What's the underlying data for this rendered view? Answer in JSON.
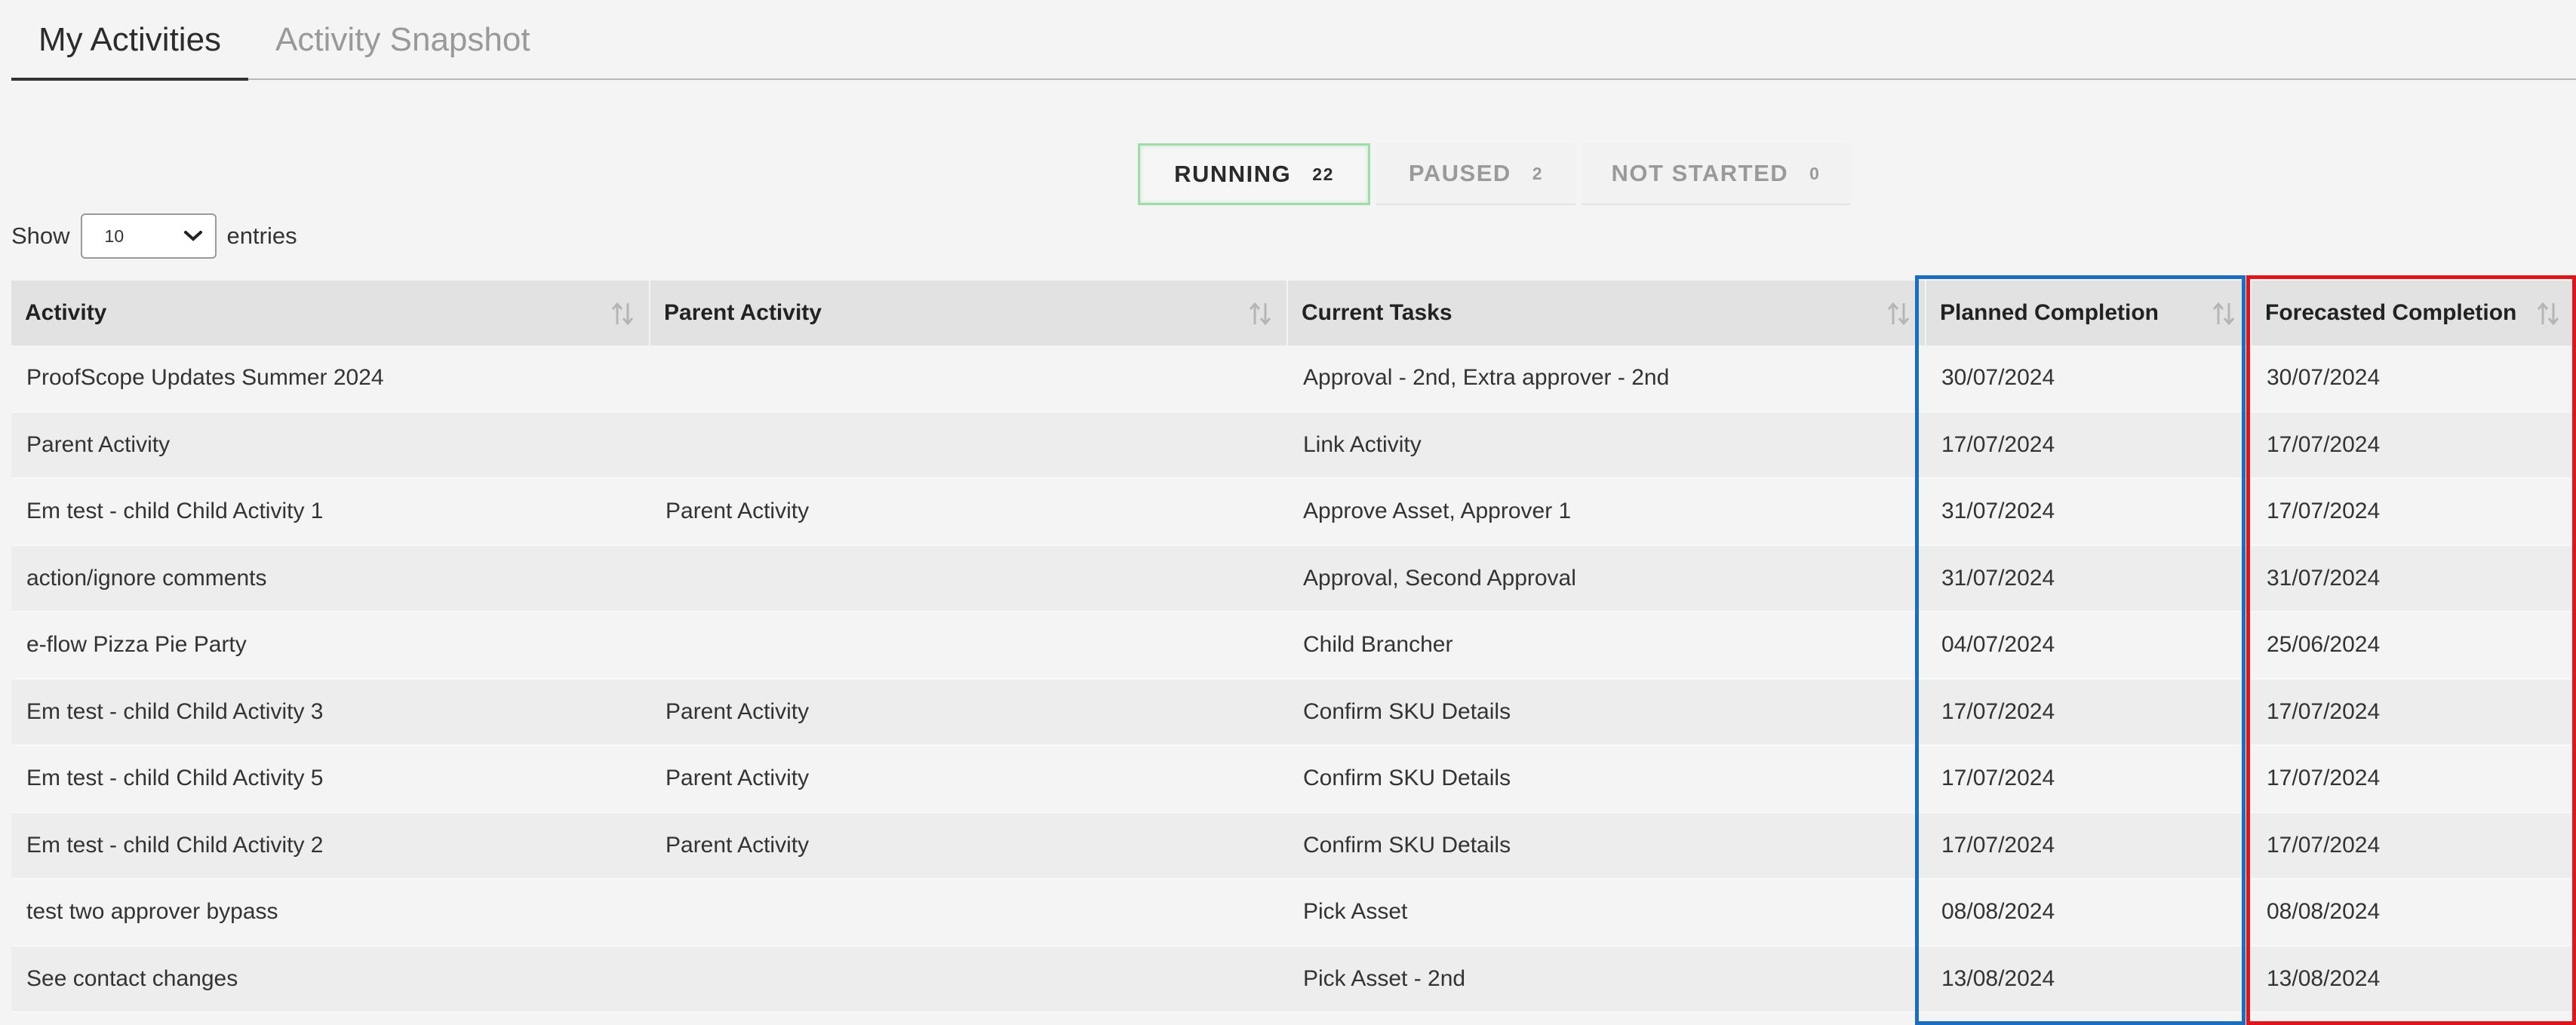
{
  "tabs": [
    {
      "label": "My Activities",
      "active": true
    },
    {
      "label": "Activity Snapshot",
      "active": false
    }
  ],
  "status": {
    "running": {
      "label": "RUNNING",
      "count": "22"
    },
    "paused": {
      "label": "PAUSED",
      "count": "2"
    },
    "not_started": {
      "label": "NOT STARTED",
      "count": "0"
    }
  },
  "entries": {
    "show_label": "Show",
    "value": "10",
    "suffix_label": "entries"
  },
  "table": {
    "columns": [
      "Activity",
      "Parent Activity",
      "Current Tasks",
      "Planned Completion",
      "Forecasted Completion"
    ],
    "rows": [
      [
        "ProofScope Updates Summer 2024",
        "",
        "Approval - 2nd, Extra approver - 2nd",
        "30/07/2024",
        "30/07/2024"
      ],
      [
        "Parent Activity",
        "",
        "Link Activity",
        "17/07/2024",
        "17/07/2024"
      ],
      [
        "Em test - child Child Activity 1",
        "Parent Activity",
        "Approve Asset, Approver 1",
        "31/07/2024",
        "17/07/2024"
      ],
      [
        "action/ignore comments",
        "",
        "Approval, Second Approval",
        "31/07/2024",
        "31/07/2024"
      ],
      [
        "e-flow Pizza Pie Party",
        "",
        "Child Brancher",
        "04/07/2024",
        "25/06/2024"
      ],
      [
        "Em test - child Child Activity 3",
        "Parent Activity",
        "Confirm SKU Details",
        "17/07/2024",
        "17/07/2024"
      ],
      [
        "Em test - child Child Activity 5",
        "Parent Activity",
        "Confirm SKU Details",
        "17/07/2024",
        "17/07/2024"
      ],
      [
        "Em test - child Child Activity 2",
        "Parent Activity",
        "Confirm SKU Details",
        "17/07/2024",
        "17/07/2024"
      ],
      [
        "test two approver bypass",
        "",
        "Pick Asset",
        "08/08/2024",
        "08/08/2024"
      ],
      [
        "See contact changes",
        "",
        "Pick Asset - 2nd",
        "13/08/2024",
        "13/08/2024"
      ]
    ]
  },
  "colors": {
    "running_border": "#9fdca8",
    "planned_highlight": "#1b6dbf",
    "forecast_highlight": "#e0141b"
  }
}
